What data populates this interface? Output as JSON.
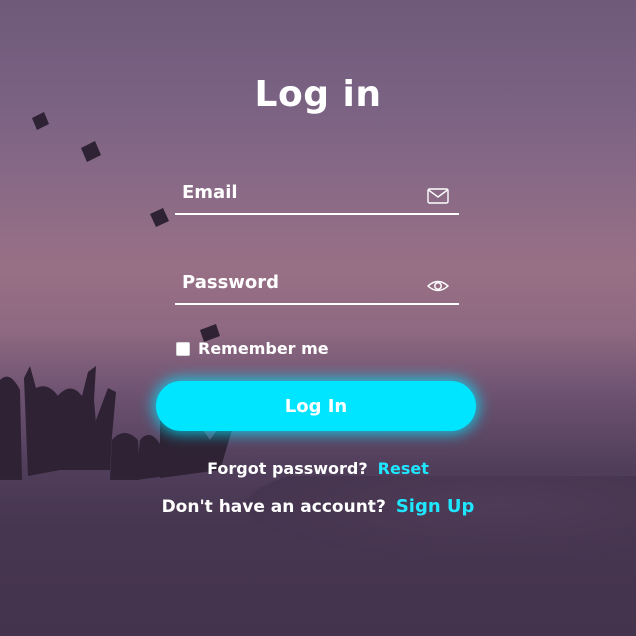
{
  "title": "Log in",
  "email": {
    "placeholder": "Email",
    "value": "",
    "icon": "envelope-icon"
  },
  "password": {
    "placeholder": "Password",
    "value": "",
    "icon": "eye-icon"
  },
  "remember": {
    "label": "Remember me",
    "checked": false
  },
  "login_button": {
    "label": "Log In"
  },
  "forgot": {
    "text": "Forgot password?",
    "link": "Reset"
  },
  "signup": {
    "text": "Don't have an account?",
    "link": "Sign Up"
  },
  "colors": {
    "accent": "#00e5ff",
    "text": "#ffffff"
  }
}
